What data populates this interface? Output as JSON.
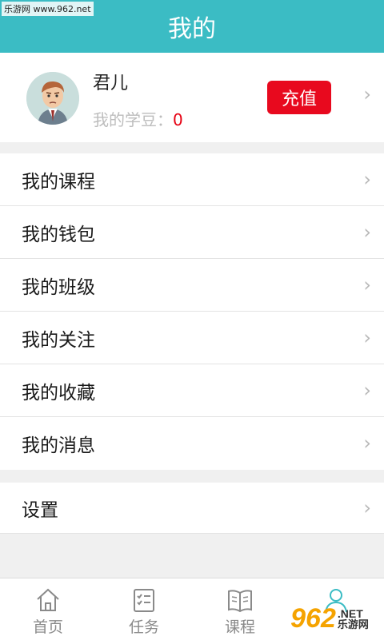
{
  "watermark": "乐游网 www.962.net",
  "header": {
    "title": "我的"
  },
  "profile": {
    "name": "君儿",
    "beans_label": "我的学豆：",
    "beans_value": "0",
    "recharge_label": "充值"
  },
  "menu": {
    "items": [
      {
        "label": "我的课程"
      },
      {
        "label": "我的钱包"
      },
      {
        "label": "我的班级"
      },
      {
        "label": "我的关注"
      },
      {
        "label": "我的收藏"
      },
      {
        "label": "我的消息"
      }
    ]
  },
  "settings": {
    "label": "设置"
  },
  "tabbar": {
    "tabs": [
      {
        "label": "首页",
        "icon": "home-icon"
      },
      {
        "label": "任务",
        "icon": "task-icon"
      },
      {
        "label": "课程",
        "icon": "book-icon"
      },
      {
        "label": "",
        "icon": "person-icon",
        "active": true
      }
    ]
  },
  "site_badge": {
    "number": "962",
    "suffix": ".NET",
    "text": "乐游网"
  },
  "colors": {
    "accent": "#3bbcc4",
    "recharge": "#e8091e",
    "beans_value": "#e60012"
  }
}
